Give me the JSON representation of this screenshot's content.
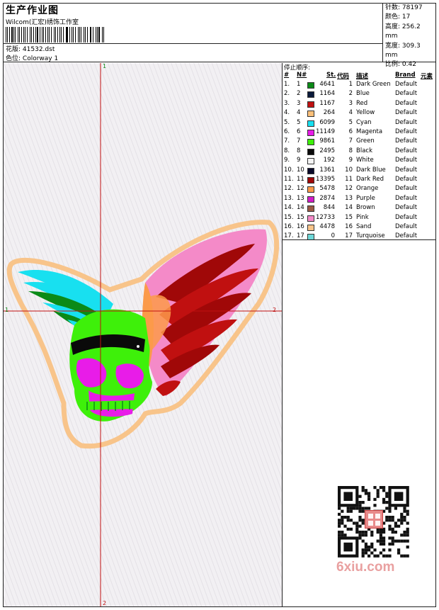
{
  "header": {
    "title": "生产作业图",
    "studio": "Wilcom(汇宏)绣饰工作室",
    "design_file_label": "花版:",
    "design_file": "41532.dst",
    "colorway_label": "色位:",
    "colorway": "Colorway 1"
  },
  "stats": [
    {
      "label": "针数:",
      "value": "78197"
    },
    {
      "label": "颜色:",
      "value": "17"
    },
    {
      "label": "高度:",
      "value": "256.2 mm"
    },
    {
      "label": "宽度:",
      "value": "309.3 mm"
    },
    {
      "label": "比例:",
      "value": "0.42"
    }
  ],
  "axis_labels": {
    "top": "1",
    "left": "1",
    "right": "2",
    "bottom": "2"
  },
  "stop_sequence": {
    "title": "停止顺序:",
    "columns": {
      "num": "#",
      "needle": "N#",
      "stitches": "St.",
      "code": "代码",
      "desc": "描述",
      "brand": "Brand",
      "element": "元素"
    },
    "rows": [
      {
        "num": "1.",
        "needle": "1",
        "color": "#0b8a17",
        "stitches": "4641",
        "code": "1",
        "desc": "Dark Green",
        "brand": "Default"
      },
      {
        "num": "2.",
        "needle": "2",
        "color": "#0b1a3a",
        "stitches": "1164",
        "code": "2",
        "desc": "Blue",
        "brand": "Default"
      },
      {
        "num": "3.",
        "needle": "3",
        "color": "#c01010",
        "stitches": "1167",
        "code": "3",
        "desc": "Red",
        "brand": "Default"
      },
      {
        "num": "4.",
        "needle": "4",
        "color": "#fbc07a",
        "stitches": "264",
        "code": "4",
        "desc": "Yellow",
        "brand": "Default"
      },
      {
        "num": "5.",
        "needle": "5",
        "color": "#18e0f0",
        "stitches": "6099",
        "code": "5",
        "desc": "Cyan",
        "brand": "Default"
      },
      {
        "num": "6.",
        "needle": "6",
        "color": "#e81ce8",
        "stitches": "11149",
        "code": "6",
        "desc": "Magenta",
        "brand": "Default"
      },
      {
        "num": "7.",
        "needle": "7",
        "color": "#3ef00a",
        "stitches": "9861",
        "code": "7",
        "desc": "Green",
        "brand": "Default"
      },
      {
        "num": "8.",
        "needle": "8",
        "color": "#0a0a0a",
        "stitches": "2495",
        "code": "8",
        "desc": "Black",
        "brand": "Default"
      },
      {
        "num": "9.",
        "needle": "9",
        "color": "#f4f4f4",
        "stitches": "192",
        "code": "9",
        "desc": "White",
        "brand": "Default"
      },
      {
        "num": "10.",
        "needle": "10",
        "color": "#0a0a2a",
        "stitches": "1361",
        "code": "10",
        "desc": "Dark Blue",
        "brand": "Default"
      },
      {
        "num": "11.",
        "needle": "11",
        "color": "#a00808",
        "stitches": "13395",
        "code": "11",
        "desc": "Dark Red",
        "brand": "Default"
      },
      {
        "num": "12.",
        "needle": "12",
        "color": "#fb9a4a",
        "stitches": "5478",
        "code": "12",
        "desc": "Orange",
        "brand": "Default"
      },
      {
        "num": "13.",
        "needle": "13",
        "color": "#d21cc8",
        "stitches": "2874",
        "code": "13",
        "desc": "Purple",
        "brand": "Default"
      },
      {
        "num": "14.",
        "needle": "14",
        "color": "#9a5a44",
        "stitches": "844",
        "code": "14",
        "desc": "Brown",
        "brand": "Default"
      },
      {
        "num": "15.",
        "needle": "15",
        "color": "#f48ac8",
        "stitches": "12733",
        "code": "15",
        "desc": "Pink",
        "brand": "Default"
      },
      {
        "num": "16.",
        "needle": "16",
        "color": "#f8c48a",
        "stitches": "4478",
        "code": "16",
        "desc": "Sand",
        "brand": "Default"
      },
      {
        "num": "17.",
        "needle": "17",
        "color": "#6ed8d8",
        "stitches": "0",
        "code": "17",
        "desc": "Turquoise",
        "brand": "Default"
      }
    ]
  },
  "watermark": "6xiu.com"
}
